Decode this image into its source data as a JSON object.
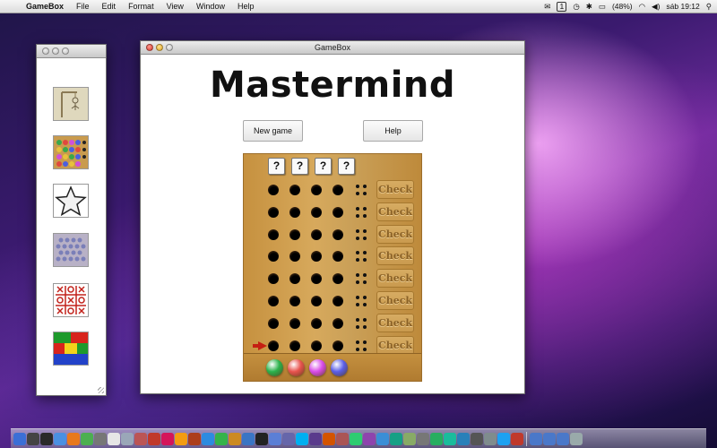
{
  "menubar": {
    "app_name": "GameBox",
    "items": [
      "File",
      "Edit",
      "Format",
      "View",
      "Window",
      "Help"
    ],
    "battery": "(48%)",
    "clock": "sáb 19:12",
    "badge": "1"
  },
  "main_window": {
    "title": "GameBox",
    "game_title": "Mastermind",
    "new_game_label": "New game",
    "help_label": "Help",
    "secret_symbol": "?",
    "check_label": "Check",
    "current_row": 8,
    "palette_colors": [
      "#2bb24c",
      "#e8534e",
      "#d94ce8",
      "#5a5ee8"
    ]
  },
  "sidebar": {
    "games": [
      "hangman",
      "color-lines",
      "star",
      "marbles",
      "tic-tac-toe",
      "color-blocks"
    ]
  },
  "dock": {
    "icons": [
      "finder-icon",
      "dashboard-icon",
      "mission-icon",
      "safari-icon",
      "firefox-icon",
      "chrome-icon",
      "mail-icon",
      "ical-icon",
      "preview-icon",
      "photo-icon",
      "flash-icon",
      "indesign-icon",
      "illustrator-icon",
      "fireworks-icon",
      "photoshop-icon",
      "dreamweaver-icon",
      "bridge-icon",
      "xcode-icon",
      "terminal-icon",
      "itunes-icon",
      "network-icon",
      "skype-icon",
      "music-icon",
      "transmit-icon",
      "pencil-icon",
      "coda-icon",
      "textmate-icon",
      "video-icon",
      "sync-icon",
      "stack-icon",
      "system-icon",
      "maps-icon",
      "facetime-icon",
      "globe-icon",
      "timemachine-icon",
      "settings-icon",
      "twitter-icon",
      "stop-icon",
      "downloads-icon",
      "documents-icon",
      "apps-icon",
      "trash-icon"
    ]
  }
}
